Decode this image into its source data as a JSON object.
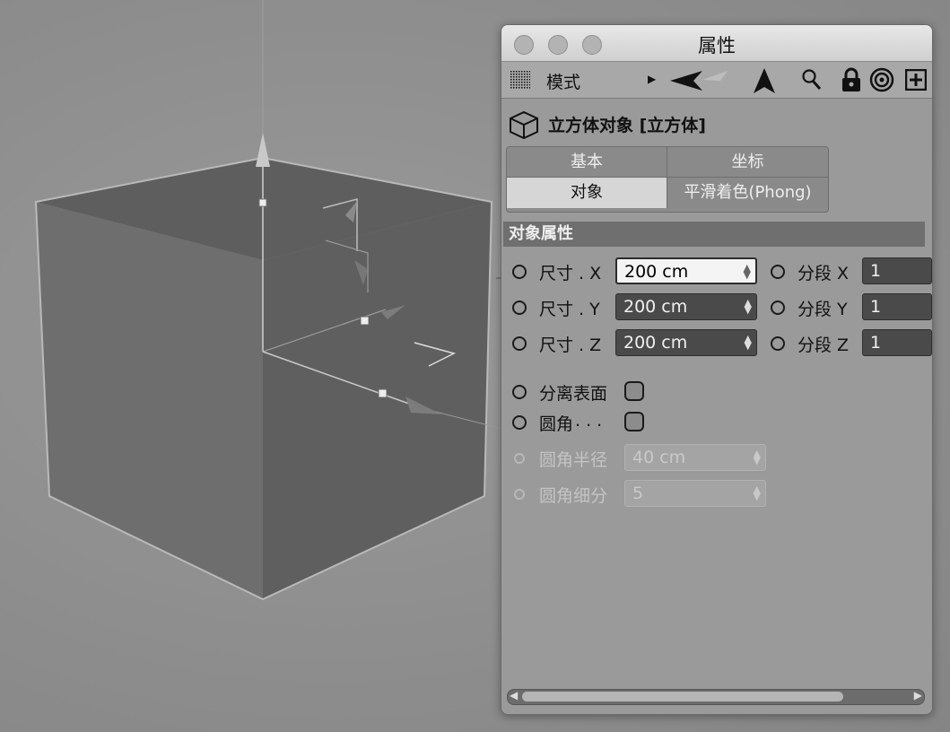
{
  "window": {
    "title": "属性"
  },
  "toolbar": {
    "mode_label": "模式"
  },
  "object": {
    "title": "立方体对象 [立方体]"
  },
  "tabs": [
    {
      "label": "基本",
      "active": false
    },
    {
      "label": "坐标",
      "active": false
    },
    {
      "label": "对象",
      "active": true
    },
    {
      "label": "平滑着色(Phong)",
      "active": false
    }
  ],
  "section": {
    "title": "对象属性"
  },
  "size": {
    "x_label": "尺寸 . X",
    "x_value": "200 cm",
    "y_label": "尺寸 . Y",
    "y_value": "200 cm",
    "z_label": "尺寸 . Z",
    "z_value": "200 cm"
  },
  "segments": {
    "x_label": "分段 X",
    "x_value": "1",
    "y_label": "分段 Y",
    "y_value": "1",
    "z_label": "分段 Z",
    "z_value": "1"
  },
  "options": {
    "separate_label": "分离表面",
    "fillet_label": "圆角",
    "fillet_dots": ". . .",
    "fillet_radius_label": "圆角半径",
    "fillet_radius_value": "40 cm",
    "fillet_subdiv_label": "圆角细分",
    "fillet_subdiv_value": "5"
  },
  "colors": {
    "panel_bg": "#9a9a9a",
    "field_bg": "#4a4a4a",
    "section_bg": "#6f6f6f"
  }
}
